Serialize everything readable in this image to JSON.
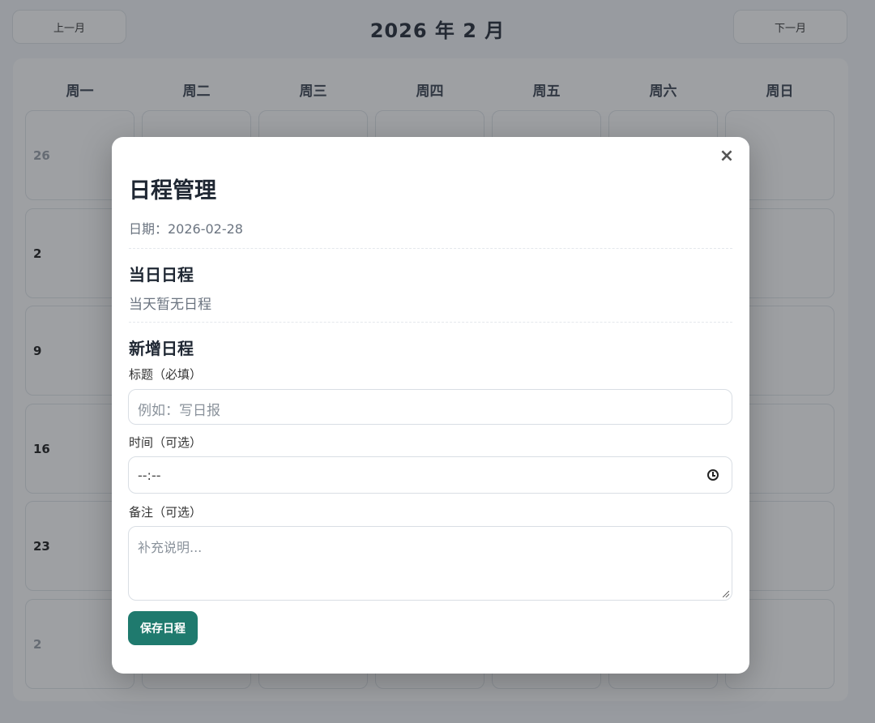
{
  "header": {
    "prev_label": "上一月",
    "next_label": "下一月",
    "month_title": "2026 年 2 月"
  },
  "calendar": {
    "weekdays": [
      "周一",
      "周二",
      "周三",
      "周四",
      "周五",
      "周六",
      "周日"
    ],
    "visible_row_start_numbers": [
      "26",
      "2",
      "9",
      "16",
      "23",
      "2"
    ]
  },
  "modal": {
    "close_label": "×",
    "title": "日程管理",
    "date_line": "日期：2026-02-28",
    "today_section_title": "当日日程",
    "today_empty_text": "当天暂无日程",
    "new_section_title": "新增日程",
    "title_field": {
      "label": "标题（必填）",
      "placeholder": "例如：写日报"
    },
    "time_field": {
      "label": "时间（可选）",
      "placeholder": "--:--"
    },
    "note_field": {
      "label": "备注（可选）",
      "placeholder": "补充说明..."
    },
    "save_label": "保存日程"
  },
  "colors": {
    "accent": "#1f7a6e",
    "background": "#f4f6f9",
    "overlay": "rgba(40,44,52,0.45)"
  }
}
